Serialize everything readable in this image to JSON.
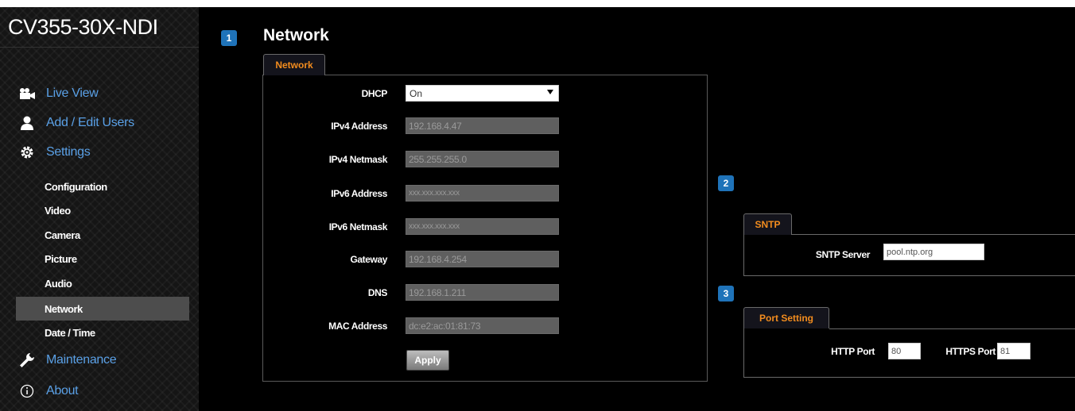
{
  "app": {
    "title": "CV355-30X-NDI"
  },
  "sidebar": {
    "main_items": [
      {
        "label": "Live View",
        "icon": "camera-icon"
      },
      {
        "label": "Add / Edit Users",
        "icon": "user-icon"
      },
      {
        "label": "Settings",
        "icon": "gear-icon"
      },
      {
        "label": "Maintenance",
        "icon": "wrench-icon"
      },
      {
        "label": "About",
        "icon": "info-icon"
      }
    ],
    "sub_items": [
      {
        "label": "Configuration"
      },
      {
        "label": "Video"
      },
      {
        "label": "Camera"
      },
      {
        "label": "Picture"
      },
      {
        "label": "Audio"
      },
      {
        "label": "Network",
        "active": true
      },
      {
        "label": "Date / Time"
      }
    ]
  },
  "badges": [
    "1",
    "2",
    "3"
  ],
  "page": {
    "title": "Network"
  },
  "network": {
    "tab": "Network",
    "fields": [
      {
        "label": "DHCP",
        "value": "On",
        "type": "select"
      },
      {
        "label": "IPv4 Address",
        "value": "192.168.4.47"
      },
      {
        "label": "IPv4 Netmask",
        "value": "255.255.255.0"
      },
      {
        "label": "IPv6 Address",
        "value": "xxx.xxx.xxx.xxx"
      },
      {
        "label": "IPv6 Netmask",
        "value": "xxx.xxx.xxx.xxx"
      },
      {
        "label": "Gateway",
        "value": "192.168.4.254"
      },
      {
        "label": "DNS",
        "value": "192.168.1.211"
      },
      {
        "label": "MAC Address",
        "value": "dc:e2:ac:01:81:73"
      }
    ],
    "apply_label": "Apply"
  },
  "sntp": {
    "tab": "SNTP",
    "server_label": "SNTP Server",
    "server_value": "pool.ntp.org"
  },
  "ports": {
    "tab": "Port Setting",
    "http_label": "HTTP Port",
    "http_value": "80",
    "https_label": "HTTPS Port",
    "https_value": "81"
  },
  "colors": {
    "accent": "#f28c1e",
    "link": "#5aa0e6",
    "badge": "#1f73b9"
  }
}
